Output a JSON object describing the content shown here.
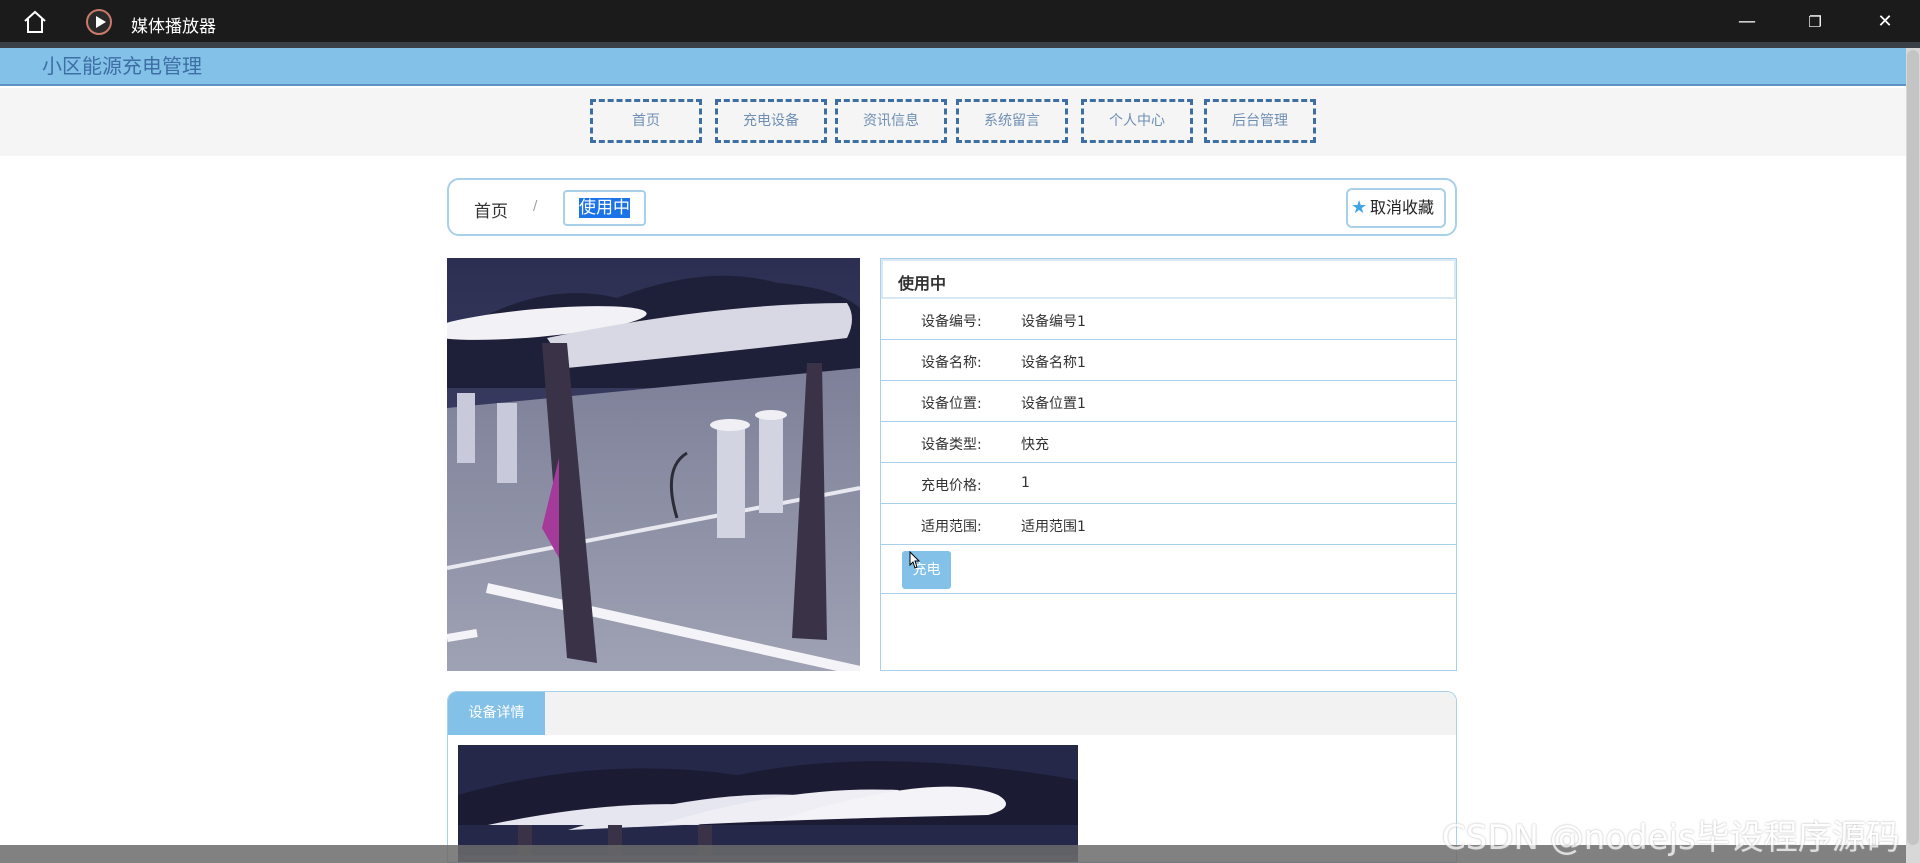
{
  "window": {
    "title": "媒体播放器",
    "controls": {
      "minimize": "—",
      "maximize": "❐",
      "close": "✕"
    }
  },
  "site": {
    "title": "小区能源充电管理"
  },
  "nav": [
    {
      "label": "首页"
    },
    {
      "label": "充电设备"
    },
    {
      "label": "资讯信息"
    },
    {
      "label": "系统留言"
    },
    {
      "label": "个人中心"
    },
    {
      "label": "后台管理"
    }
  ],
  "breadcrumb": {
    "home": "首页",
    "separator": "/",
    "current": "使用中"
  },
  "favorite": {
    "label": "取消收藏",
    "icon": "star-icon"
  },
  "device": {
    "status": "使用中",
    "fields": [
      {
        "label": "设备编号:",
        "value": "设备编号1"
      },
      {
        "label": "设备名称:",
        "value": "设备名称1"
      },
      {
        "label": "设备位置:",
        "value": "设备位置1"
      },
      {
        "label": "设备类型:",
        "value": "快充"
      },
      {
        "label": "充电价格:",
        "value": "1"
      },
      {
        "label": "适用范围:",
        "value": "适用范围1"
      }
    ],
    "action_label": "充电"
  },
  "tabs": [
    {
      "label": "设备详情"
    }
  ],
  "watermark": "CSDN @nodejs毕设程序源码",
  "colors": {
    "accent": "#84c1e8",
    "brand": "#3d6fa4",
    "titlebar": "#1b1b1b"
  }
}
